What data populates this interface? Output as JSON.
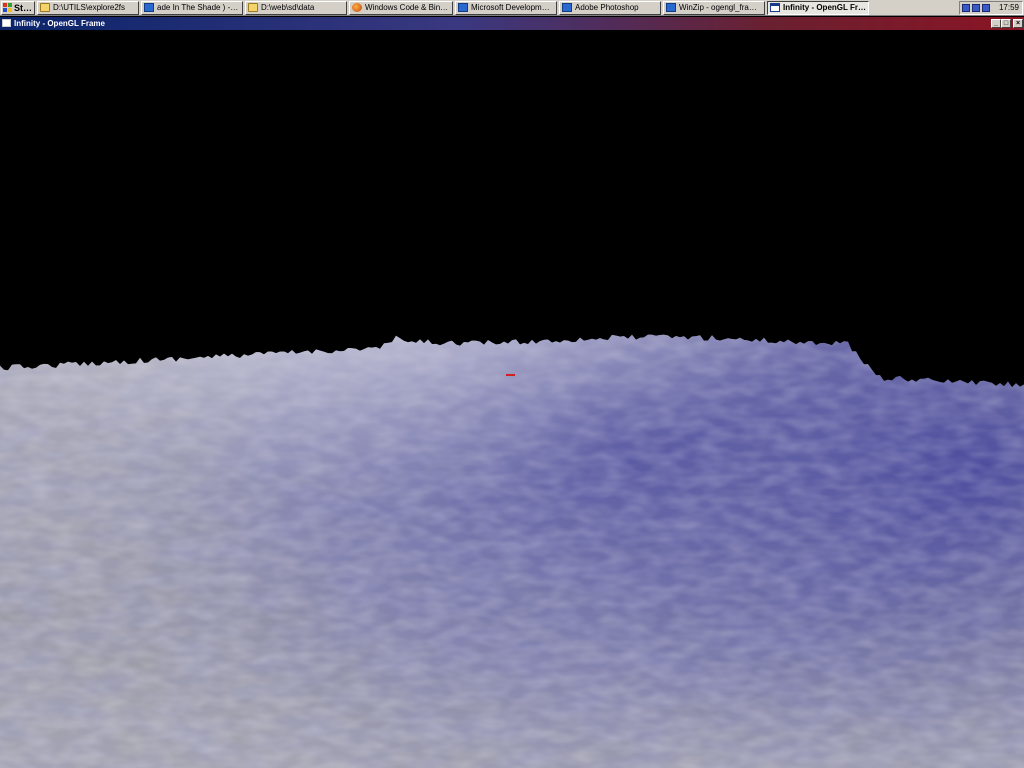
{
  "taskbar": {
    "start_label": "Start",
    "buttons": [
      {
        "label": "D:\\UTILS\\explore2fs",
        "icon": "folder-icon"
      },
      {
        "label": "ade In The Shade ) - Bitc...",
        "icon": "app-icon"
      },
      {
        "label": "D:\\web\\sd\\data",
        "icon": "folder-icon"
      },
      {
        "label": "Windows Code & Binarie...",
        "icon": "browser-icon"
      },
      {
        "label": "Microsoft Development E...",
        "icon": "app-icon"
      },
      {
        "label": "Adobe Photoshop",
        "icon": "app-icon"
      },
      {
        "label": "WinZip - ogengl_frame_...",
        "icon": "app-icon"
      },
      {
        "label": "Infinity - OpenGL Fra...",
        "icon": "window-icon",
        "active": true
      }
    ],
    "clock": "17:59"
  },
  "window": {
    "title": "Infinity - OpenGL Frame",
    "minimize": "_",
    "maximize": "□",
    "close": "×"
  },
  "scene": {
    "sky_color": "#000000",
    "terrain_light": "#f0f0f4",
    "terrain_grey": "#9a9aa4",
    "terrain_blue": "#5a5a9c",
    "marker_color": "#d02020"
  }
}
